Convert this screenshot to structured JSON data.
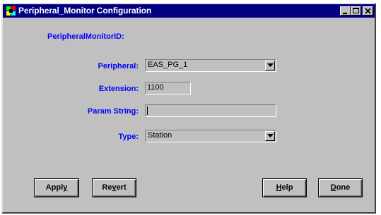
{
  "window": {
    "title": "Peripheral_Monitor Configuration"
  },
  "form": {
    "id_label": "PeripheralMonitorID:",
    "peripheral_label": "Peripheral:",
    "peripheral_value": "EAS_PG_1",
    "extension_label": "Extension:",
    "extension_value": "1100",
    "param_label": "Param String:",
    "param_value": "",
    "type_label": "Type:",
    "type_value": "Station"
  },
  "buttons": {
    "apply_pre": "Appl",
    "apply_key": "y",
    "revert_pre": "Re",
    "revert_key": "v",
    "revert_post": "ert",
    "help_key": "H",
    "help_post": "elp",
    "done_key": "D",
    "done_post": "one"
  },
  "colors": {
    "titlebar": "#000080",
    "label": "#0000ff",
    "face": "#c0c0c0"
  },
  "icons": [
    "app-icon",
    "minimize-icon",
    "maximize-icon",
    "close-icon",
    "dropdown-arrow-icon"
  ]
}
